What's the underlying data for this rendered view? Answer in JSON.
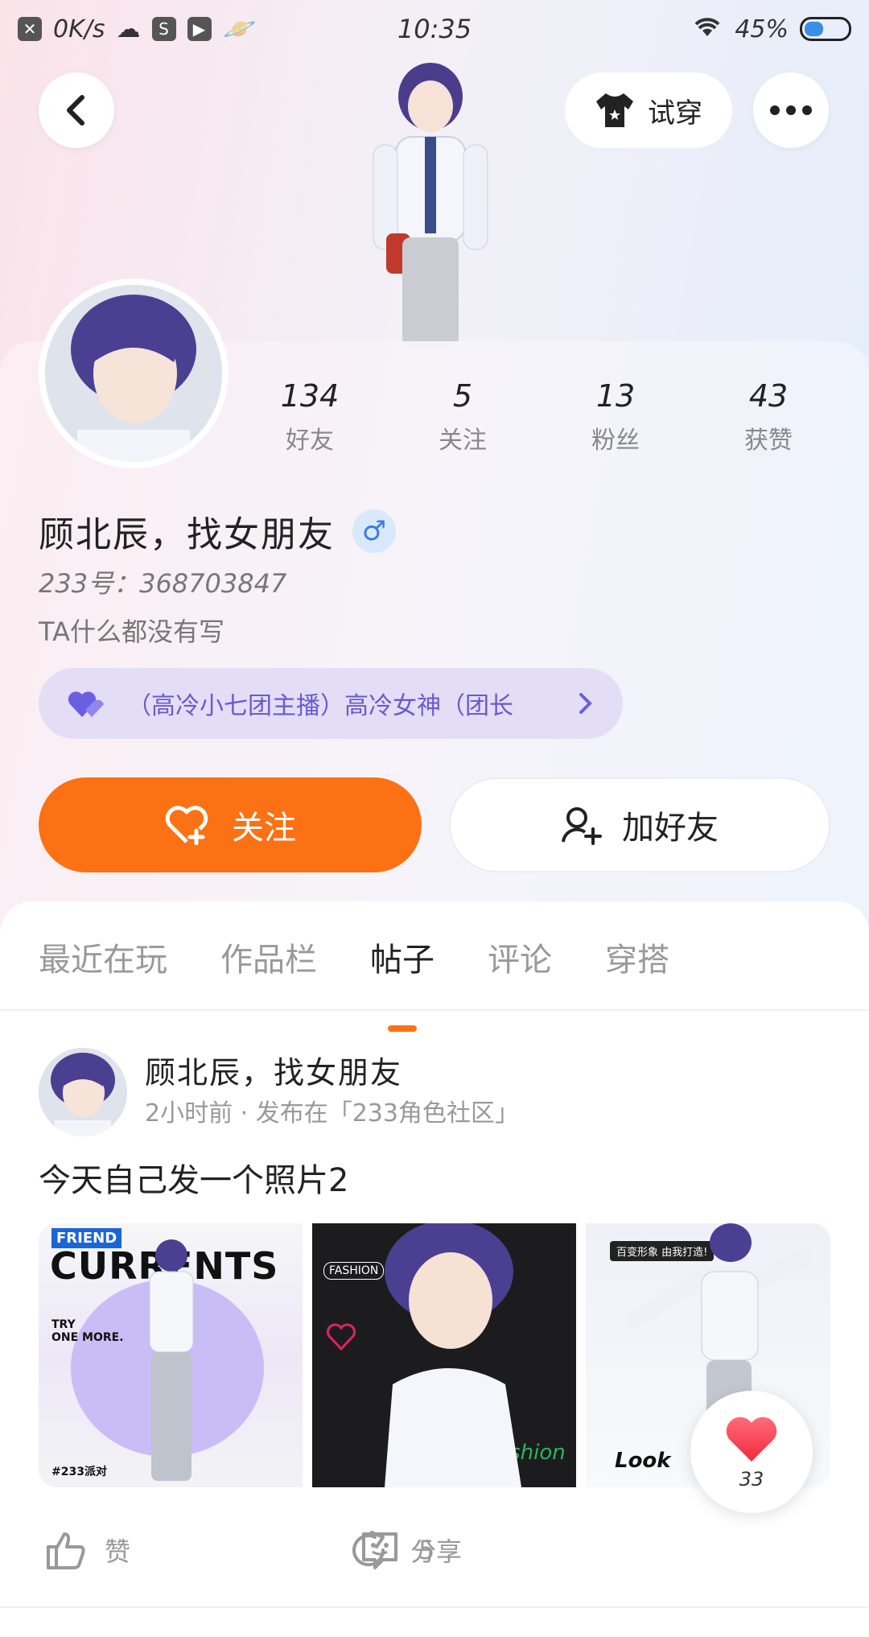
{
  "status_bar": {
    "speed": "0K/s",
    "time": "10:35",
    "battery": "45%",
    "battery_level": 0.45
  },
  "header": {
    "tryon_label": "试穿"
  },
  "profile": {
    "stats": [
      {
        "value": "134",
        "label": "好友"
      },
      {
        "value": "5",
        "label": "关注"
      },
      {
        "value": "13",
        "label": "粉丝"
      },
      {
        "value": "43",
        "label": "获赞"
      }
    ],
    "name": "顾北辰，找女朋友",
    "gender_symbol": "♂",
    "uid": "233号：368703847",
    "bio": "TA什么都没有写",
    "group": "（高冷小七团主播）高冷女神（团长",
    "follow_label": "关注",
    "add_friend_label": "加好友"
  },
  "tabs": [
    {
      "label": "最近在玩"
    },
    {
      "label": "作品栏"
    },
    {
      "label": "帖子"
    },
    {
      "label": "评论"
    },
    {
      "label": "穿搭"
    }
  ],
  "post": {
    "author": "顾北辰，找女朋友",
    "meta": "2小时前 · 发布在「233角色社区」",
    "text": "今天自己发一个照片2",
    "image1_texts": [
      "FRIEND",
      "CURRENTS",
      "TRY\nONE MORE.",
      "#233派对"
    ],
    "image2_texts": [
      "FASHION",
      "fashion"
    ],
    "image3_texts": [
      "百变形象 由我打造!",
      "Look"
    ],
    "like_count": "33",
    "actions": [
      {
        "label": "赞"
      },
      {
        "label": "5"
      },
      {
        "label": "分享"
      }
    ]
  }
}
